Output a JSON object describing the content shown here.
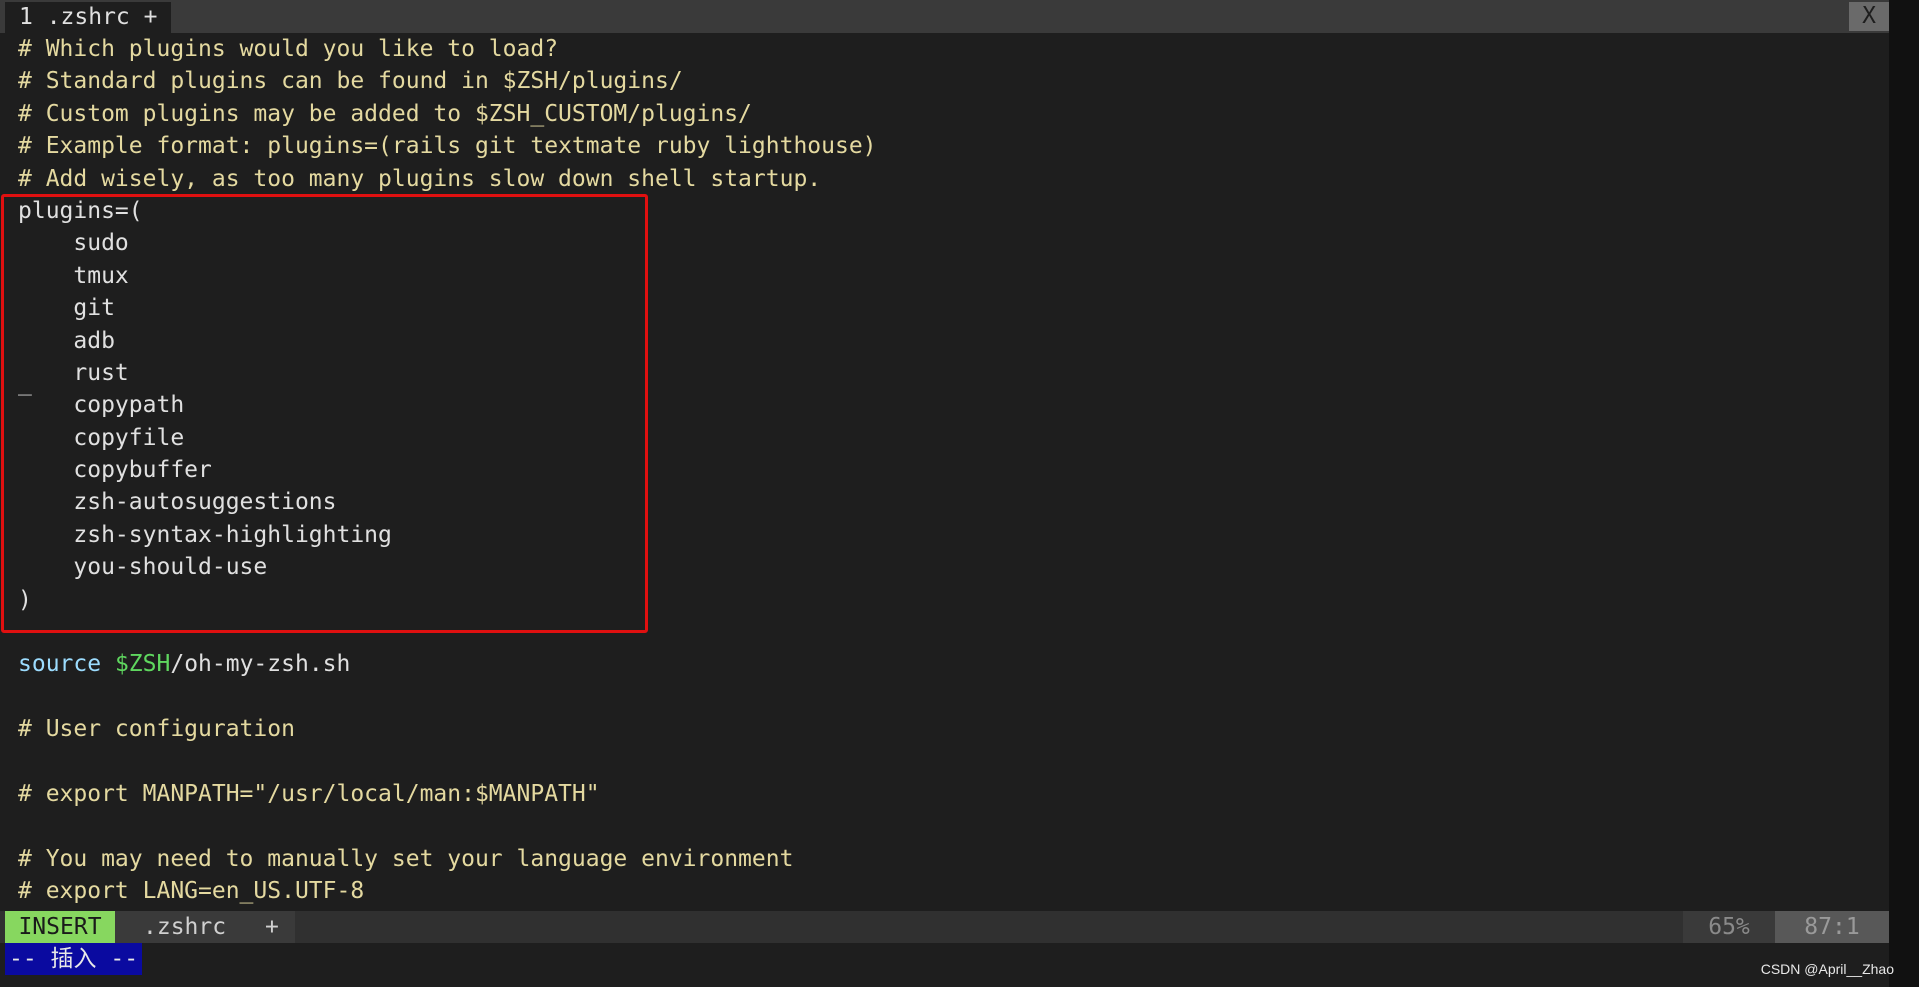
{
  "tabline": {
    "tab_label": "1 .zshrc +",
    "close_label": "X"
  },
  "editor": {
    "lines": [
      {
        "kind": "comment",
        "text": "# Which plugins would you like to load?"
      },
      {
        "kind": "comment",
        "text": "# Standard plugins can be found in $ZSH/plugins/"
      },
      {
        "kind": "comment",
        "text": "# Custom plugins may be added to $ZSH_CUSTOM/plugins/"
      },
      {
        "kind": "comment",
        "text": "# Example format: plugins=(rails git textmate ruby lighthouse)"
      },
      {
        "kind": "comment",
        "text": "# Add wisely, as too many plugins slow down shell startup."
      },
      {
        "kind": "plain",
        "text": "plugins=("
      },
      {
        "kind": "plain",
        "text": "    sudo"
      },
      {
        "kind": "plain",
        "text": "    tmux"
      },
      {
        "kind": "plain",
        "text": "    git"
      },
      {
        "kind": "plain",
        "text": "    adb"
      },
      {
        "kind": "plain",
        "text": "    rust"
      },
      {
        "kind": "plain",
        "text": "    copypath"
      },
      {
        "kind": "plain",
        "text": "    copyfile"
      },
      {
        "kind": "plain",
        "text": "    copybuffer"
      },
      {
        "kind": "plain",
        "text": "    zsh-autosuggestions"
      },
      {
        "kind": "plain",
        "text": "    zsh-syntax-highlighting"
      },
      {
        "kind": "plain",
        "text": "    you-should-use"
      },
      {
        "kind": "plain",
        "text": ")"
      },
      {
        "kind": "plain",
        "text": ""
      },
      {
        "kind": "source",
        "keyword": "source",
        "variable": "$ZSH",
        "rest": "/oh-my-zsh.sh"
      },
      {
        "kind": "plain",
        "text": ""
      },
      {
        "kind": "comment",
        "text": "# User configuration"
      },
      {
        "kind": "plain",
        "text": ""
      },
      {
        "kind": "comment",
        "text": "# export MANPATH=\"/usr/local/man:$MANPATH\""
      },
      {
        "kind": "plain",
        "text": ""
      },
      {
        "kind": "comment",
        "text": "# You may need to manually set your language environment"
      },
      {
        "kind": "comment",
        "text": "# export LANG=en_US.UTF-8"
      }
    ],
    "cursor_glyph": "_"
  },
  "statusline": {
    "mode": "INSERT",
    "file_name": ".zshrc",
    "modified_flag": "+",
    "percent": "65%",
    "position": "87:1"
  },
  "cmdline": {
    "message": "-- 插入 --"
  },
  "watermark": "CSDN @April__Zhao",
  "colors": {
    "background": "#1e1e1e",
    "comment": "#e4d9a0",
    "keyword": "#9cdcfe",
    "variable": "#5fd75f",
    "mode_bg": "#87d75f",
    "insert_msg_bg": "#0a0aa0",
    "highlight_border": "#e01010"
  }
}
